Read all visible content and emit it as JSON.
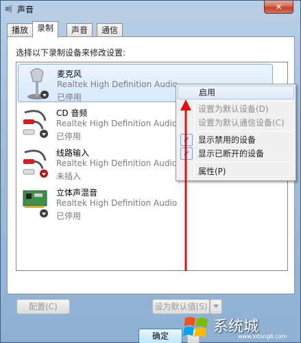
{
  "window": {
    "title": "声音",
    "close_label": "✕"
  },
  "tabs": [
    {
      "label": "播放"
    },
    {
      "label": "录制"
    },
    {
      "label": "声音"
    },
    {
      "label": "通信"
    }
  ],
  "instruction": "选择以下录制设备来修改设置:",
  "devices": [
    {
      "name": "麦克风",
      "description": "Realtek High Definition Audio",
      "status": "已停用",
      "icon": "microphone-icon"
    },
    {
      "name": "CD 音频",
      "description": "Realtek High Definition Audio",
      "status": "已停用",
      "icon": "rca-cable-icon"
    },
    {
      "name": "线路输入",
      "description": "Realtek High Definition Audio",
      "status": "未插入",
      "icon": "rca-cable-icon"
    },
    {
      "name": "立体声混音",
      "description": "Realtek High Definition Audio",
      "status": "已停用",
      "icon": "sound-card-icon"
    }
  ],
  "buttons": {
    "configure": "配置(C)",
    "set_default": "设为默认值(S)",
    "ok": "确定"
  },
  "context_menu": {
    "items": [
      {
        "label": "启用",
        "state": "hover"
      },
      {
        "label": "设置为默认设备(D)",
        "state": "disabled"
      },
      {
        "label": "设置为默认通信设备(C)",
        "state": "disabled"
      },
      {
        "label": "显示禁用的设备",
        "checked": true
      },
      {
        "label": "显示已断开的设备",
        "checked": true
      },
      {
        "label": "属性(P)"
      }
    ]
  },
  "watermark": {
    "text": "系统城",
    "url": "www.xitong8.com"
  },
  "colors": {
    "annotation_arrow": "#e01010",
    "selection": "#d7e9fb",
    "check": "#1a3a78"
  }
}
